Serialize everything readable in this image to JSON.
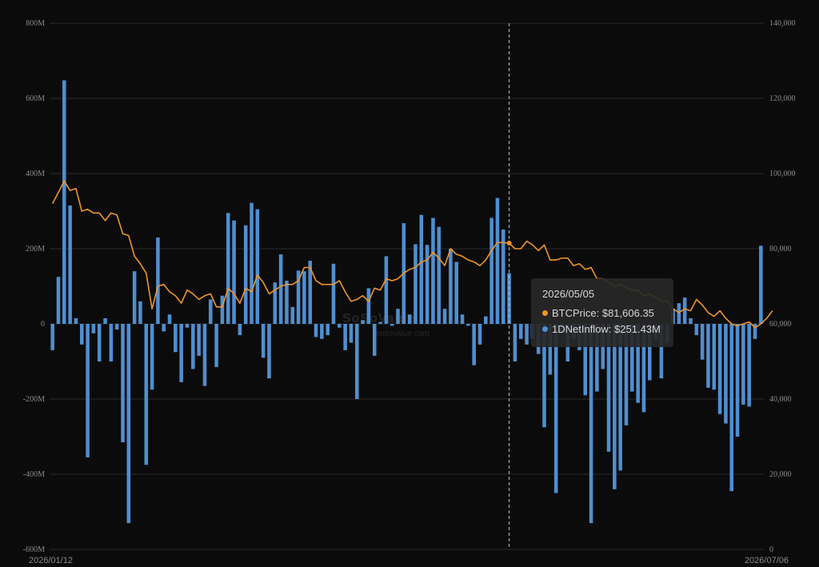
{
  "chart_data": {
    "type": "bar",
    "x_start": "2026/01/12",
    "x_end": "2026/07/06",
    "left_axis": {
      "ticks": [
        "800M",
        "600M",
        "400M",
        "200M",
        "0",
        "-200M",
        "-400M",
        "-600M"
      ],
      "ylim": [
        -600,
        800
      ],
      "unit": "M"
    },
    "right_axis": {
      "ticks": [
        "140,000",
        "120,000",
        "100,000",
        "80,000",
        "60,000",
        "40,000",
        "20,000",
        "0"
      ],
      "ylim": [
        0,
        140000
      ]
    },
    "grid": true,
    "series": [
      {
        "name": "1DNetInflow",
        "type": "bar",
        "color": "#4f8fd0",
        "values": [
          -70,
          125,
          648,
          315,
          15,
          -55,
          -355,
          -25,
          -100,
          15,
          -100,
          -15,
          -315,
          -530,
          140,
          60,
          -375,
          -175,
          230,
          -20,
          25,
          -75,
          -155,
          -10,
          -120,
          -85,
          -165,
          65,
          -115,
          75,
          295,
          275,
          -30,
          262,
          322,
          305,
          -90,
          -145,
          110,
          185,
          115,
          45,
          142,
          140,
          168,
          -35,
          -40,
          -30,
          160,
          -10,
          -70,
          -50,
          -200,
          10,
          95,
          -85,
          5,
          180,
          -5,
          40,
          268,
          25,
          212,
          290,
          210,
          282,
          258,
          40,
          200,
          165,
          25,
          -5,
          -110,
          -55,
          20,
          282,
          335,
          251,
          135,
          -100,
          -40,
          -55,
          -40,
          -80,
          -275,
          -135,
          -450,
          -25,
          -100,
          -40,
          -70,
          -190,
          -530,
          -180,
          -120,
          -340,
          -440,
          -390,
          -270,
          -180,
          -210,
          -235,
          -150,
          -40,
          -145,
          -50,
          40,
          55,
          70,
          15,
          -30,
          -95,
          -170,
          -175,
          -240,
          -265,
          -445,
          -300,
          -215,
          -220,
          -40,
          208
        ]
      },
      {
        "name": "BTCPrice",
        "type": "line",
        "color": "#f0952c",
        "values": [
          92000,
          95000,
          98000,
          95500,
          96000,
          90000,
          90500,
          89500,
          89500,
          87500,
          89500,
          89000,
          84000,
          83500,
          78000,
          76000,
          73500,
          64000,
          70000,
          70500,
          68500,
          67500,
          65500,
          69000,
          68000,
          66500,
          67500,
          68000,
          64500,
          64500,
          69500,
          68000,
          65500,
          69500,
          68500,
          73000,
          71000,
          68000,
          69000,
          70000,
          70500,
          70500,
          71500,
          75000,
          75000,
          71500,
          70500,
          70500,
          70500,
          71500,
          68500,
          66000,
          66500,
          67500,
          66000,
          69500,
          69000,
          72000,
          71500,
          72000,
          73500,
          74500,
          75000,
          76500,
          77000,
          79000,
          77500,
          75500,
          80000,
          78500,
          78000,
          77000,
          76500,
          75500,
          77000,
          79500,
          81700,
          81606,
          81500,
          80000,
          80000,
          82000,
          81000,
          79500,
          81000,
          77000,
          77000,
          77500,
          77500,
          75500,
          76000,
          74500,
          75000,
          72000,
          72000,
          71000,
          70000,
          70500,
          69500,
          69000,
          69000,
          67500,
          68000,
          67000,
          66000,
          66000,
          64000,
          63000,
          64000,
          63500,
          66500,
          65000,
          63000,
          62000,
          63500,
          61500,
          60000,
          59500,
          60000,
          60500,
          59000,
          60000,
          61500,
          63500
        ]
      }
    ],
    "highlight_index": 78
  },
  "tooltip": {
    "date": "2026/05/05",
    "price_label": "BTCPrice: $81,606.35",
    "inflow_label": "1DNetInflow: $251.43M",
    "price_color": "#f0952c",
    "inflow_color": "#4f8fd0"
  },
  "watermark": {
    "brand": "SoSoValue",
    "url": "sosovalue.com"
  }
}
